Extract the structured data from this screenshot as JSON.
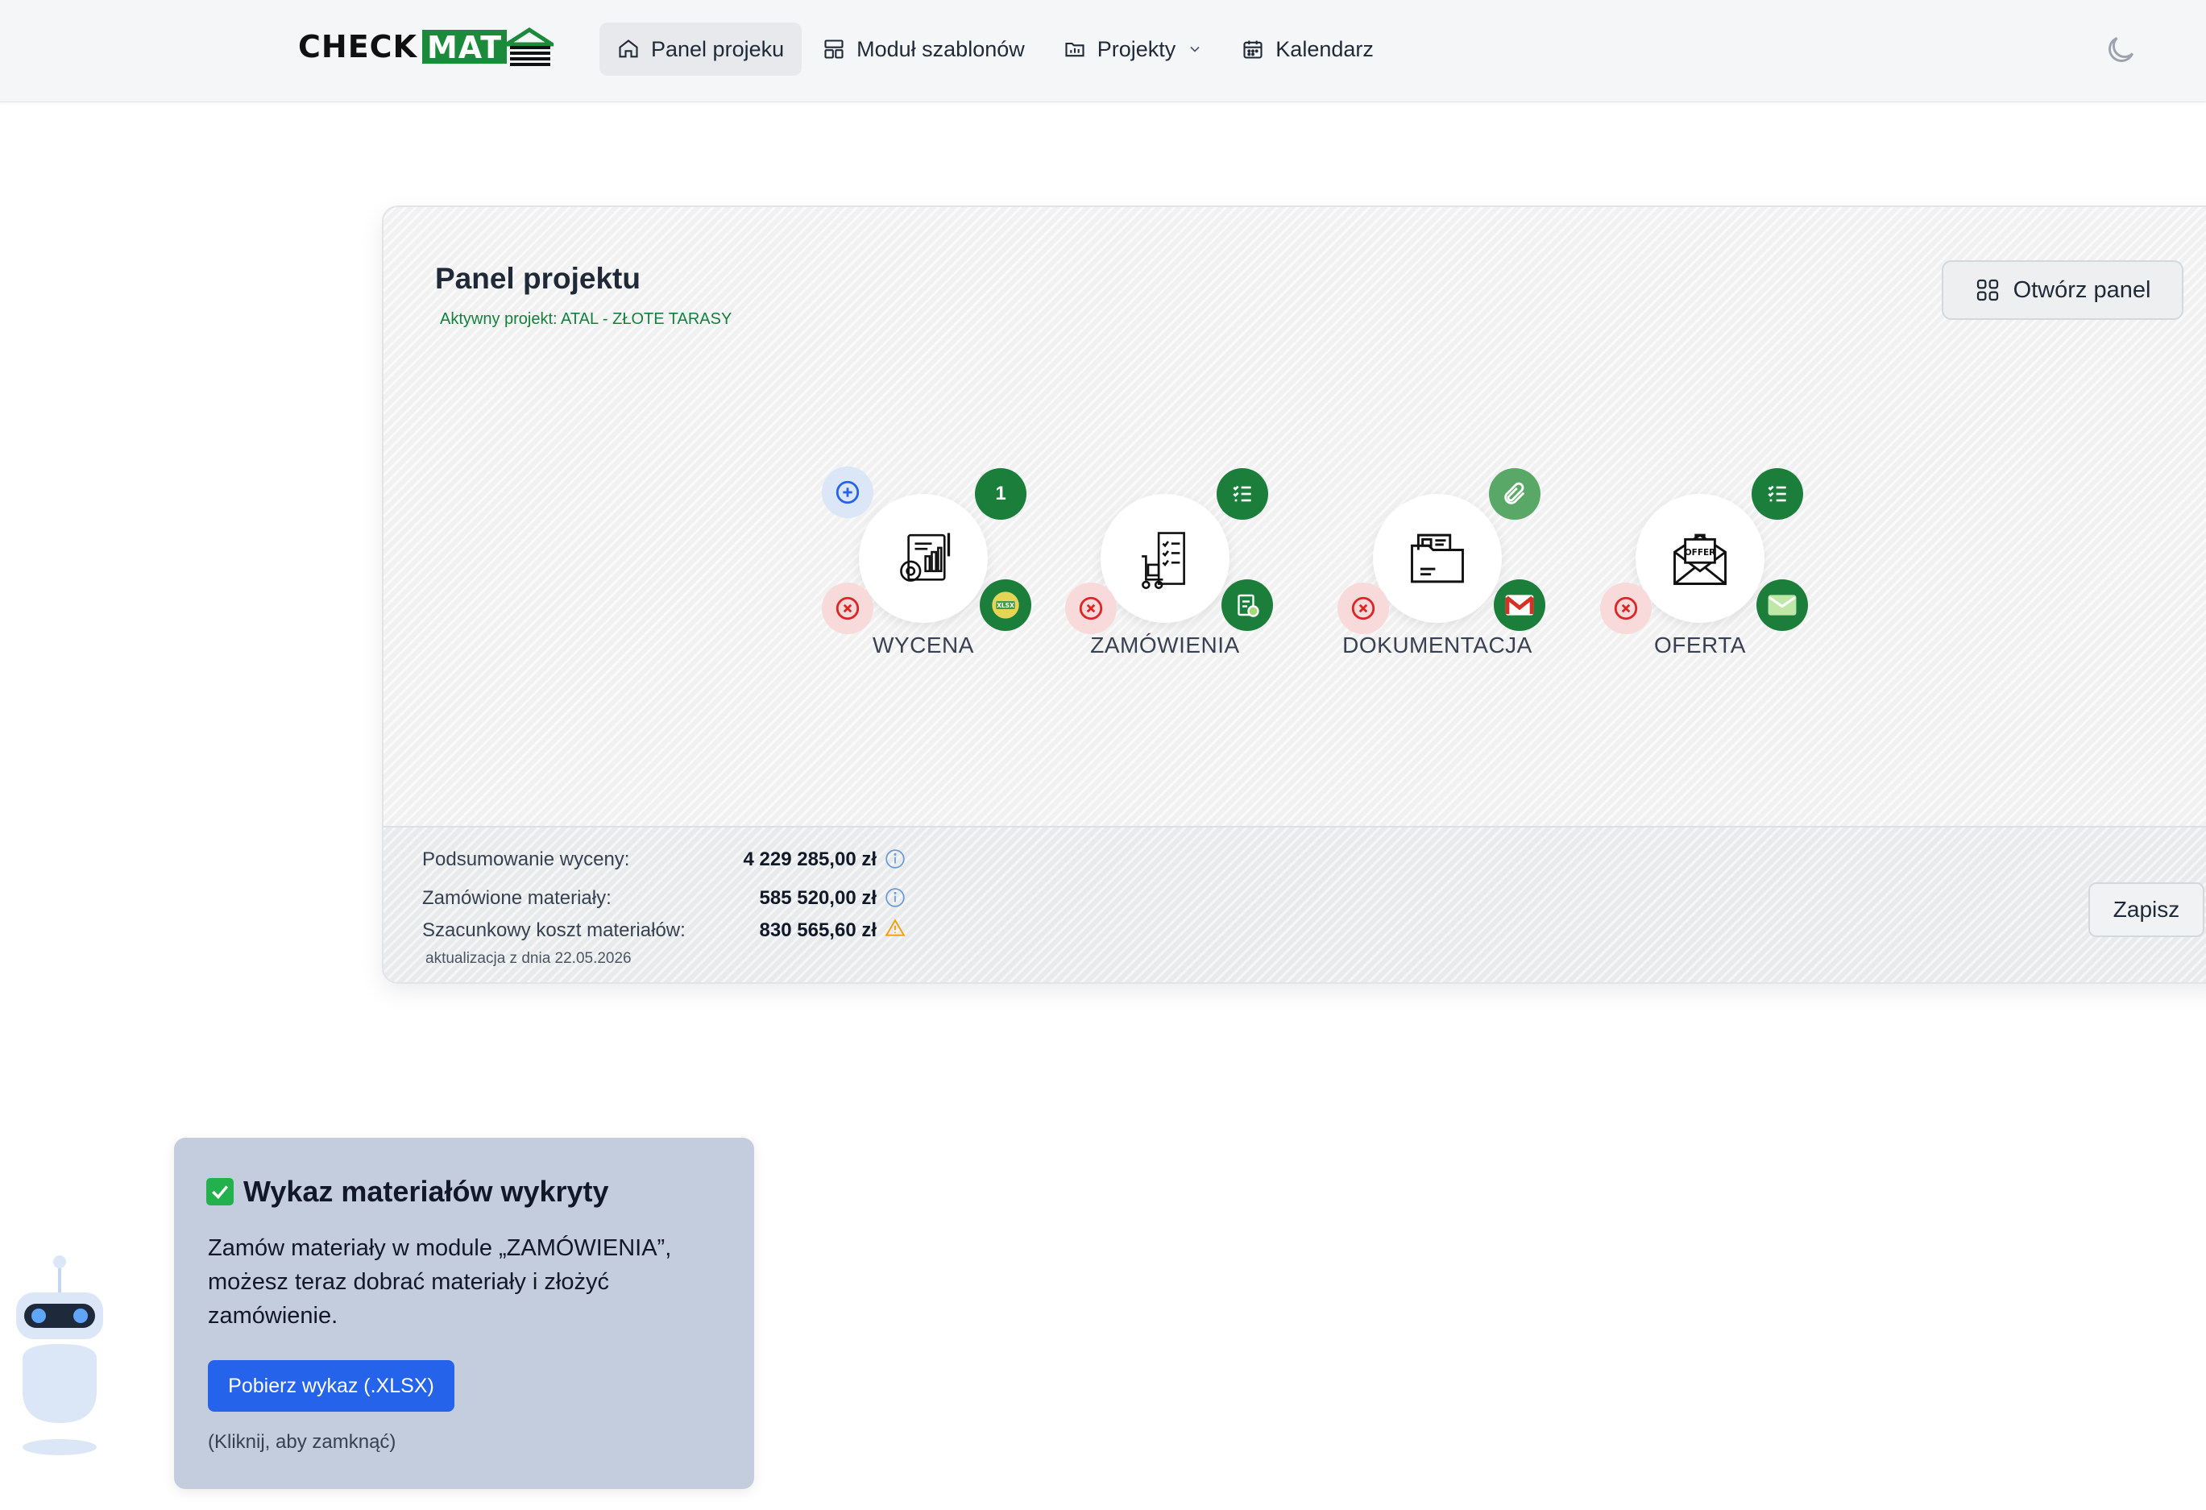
{
  "nav": {
    "logo_check": "CHECK",
    "logo_mat": "MAT",
    "items": [
      {
        "label": "Panel projeku",
        "icon": "home-icon"
      },
      {
        "label": "Moduł szablonów",
        "icon": "layout-icon"
      },
      {
        "label": "Projekty",
        "icon": "folder-chart-icon"
      },
      {
        "label": "Kalendarz",
        "icon": "calendar-icon"
      }
    ],
    "theme_icon": "moon-icon"
  },
  "panel": {
    "title": "Panel projektu",
    "active_project": "Aktywny projekt: ATAL - ZŁOTE TARASY",
    "open_button": "Otwórz panel",
    "modules": [
      {
        "label": "WYCENA",
        "badge_count": "1",
        "icon": "pricing-document-icon"
      },
      {
        "label": "ZAMÓWIENIA",
        "icon": "order-trolley-icon"
      },
      {
        "label": "DOKUMENTACJA",
        "icon": "document-folder-icon"
      },
      {
        "label": "OFERTA",
        "icon": "offer-envelope-icon"
      }
    ],
    "summary": {
      "pricing_label": "Podsumowanie wyceny:",
      "pricing_value": "4 229 285,00 zł",
      "ordered_label": "Zamówione materiały:",
      "ordered_value": "585 520,00 zł",
      "estimate_label": "Szacunkowy koszt materiałów:",
      "estimate_value": "830 565,60 zł",
      "update_note": "aktualizacja z dnia 22.05.2026",
      "save_button": "Zapisz"
    }
  },
  "assistant": {
    "title": "Wykaz materiałów wykryty",
    "text": "Zamów materiały w module „ZAMÓWIENIA”, możesz teraz dobrać materiały i złożyć zamówienie.",
    "button": "Pobierz wykaz (.XLSX)",
    "hint": "(Kliknij, aby zamknąć)"
  },
  "colors": {
    "brand_green": "#1b7f3b",
    "primary_blue": "#2563eb",
    "warning": "#f59e0b",
    "danger": "#dc2626"
  }
}
